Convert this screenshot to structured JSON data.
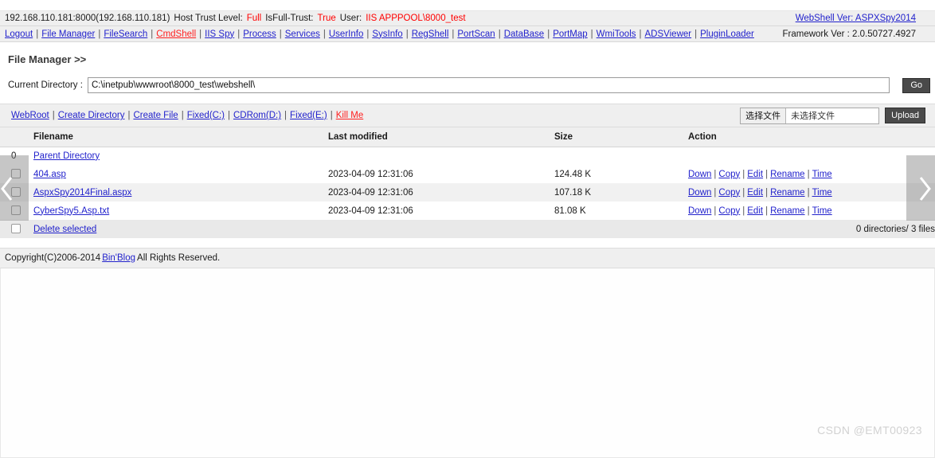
{
  "hostbar": {
    "address": "192.168.110.181:8000(192.168.110.181)",
    "trust_label": "Host Trust Level:",
    "trust_value": "Full",
    "isfulltrust_label": "IsFull-Trust:",
    "isfulltrust_value": "True",
    "user_label": "User:",
    "user_value": "IIS APPPOOL\\8000_test",
    "webshell_ver": "WebShell Ver: ASPXSpy2014"
  },
  "navbar": {
    "items": [
      {
        "label": "Logout",
        "danger": false
      },
      {
        "label": "File Manager",
        "danger": false
      },
      {
        "label": "FileSearch",
        "danger": false
      },
      {
        "label": "CmdShell",
        "danger": true
      },
      {
        "label": "IIS Spy",
        "danger": false
      },
      {
        "label": "Process",
        "danger": false
      },
      {
        "label": "Services",
        "danger": false
      },
      {
        "label": "UserInfo",
        "danger": false
      },
      {
        "label": "SysInfo",
        "danger": false
      },
      {
        "label": "RegShell",
        "danger": false
      },
      {
        "label": "PortScan",
        "danger": false
      },
      {
        "label": "DataBase",
        "danger": false
      },
      {
        "label": "PortMap",
        "danger": false
      },
      {
        "label": "WmiTools",
        "danger": false
      },
      {
        "label": "ADSViewer",
        "danger": false
      },
      {
        "label": "PluginLoader",
        "danger": false
      }
    ],
    "framework_ver": "Framework Ver : 2.0.50727.4927"
  },
  "filemanager": {
    "title": "File Manager >>",
    "current_directory_label": "Current Directory :",
    "current_directory_value": "C:\\inetpub\\wwwroot\\8000_test\\webshell\\",
    "go_label": "Go"
  },
  "toolbar": {
    "items": [
      {
        "label": "WebRoot",
        "danger": false
      },
      {
        "label": "Create Directory",
        "danger": false
      },
      {
        "label": "Create File",
        "danger": false
      },
      {
        "label": "Fixed(C:)",
        "danger": false
      },
      {
        "label": "CDRom(D:)",
        "danger": false
      },
      {
        "label": "Fixed(E:)",
        "danger": false
      },
      {
        "label": "Kill Me",
        "danger": true
      }
    ],
    "choose_file_label": "选择文件",
    "no_file_label": "未选择文件",
    "upload_label": "Upload"
  },
  "table": {
    "headers": [
      "",
      "Filename",
      "Last modified",
      "Size",
      "Action"
    ],
    "parent_index": "0",
    "parent_label": "Parent Directory",
    "action_links": [
      "Down",
      "Copy",
      "Edit",
      "Rename",
      "Time"
    ],
    "rows": [
      {
        "filename": "404.asp",
        "modified": "2023-04-09 12:31:06",
        "size": "124.48 K"
      },
      {
        "filename": "AspxSpy2014Final.aspx",
        "modified": "2023-04-09 12:31:06",
        "size": "107.18 K"
      },
      {
        "filename": "CyberSpy5.Asp.txt",
        "modified": "2023-04-09 12:31:06",
        "size": "81.08 K"
      }
    ],
    "delete_selected_label": "Delete selected",
    "summary": "0 directories/ 3 files"
  },
  "footer": {
    "copyright_prefix": "Copyright(C)2006-2014",
    "copyright_link": "Bin'Blog",
    "copyright_suffix": "All Rights Reserved."
  },
  "watermark": "CSDN @EMT00923"
}
